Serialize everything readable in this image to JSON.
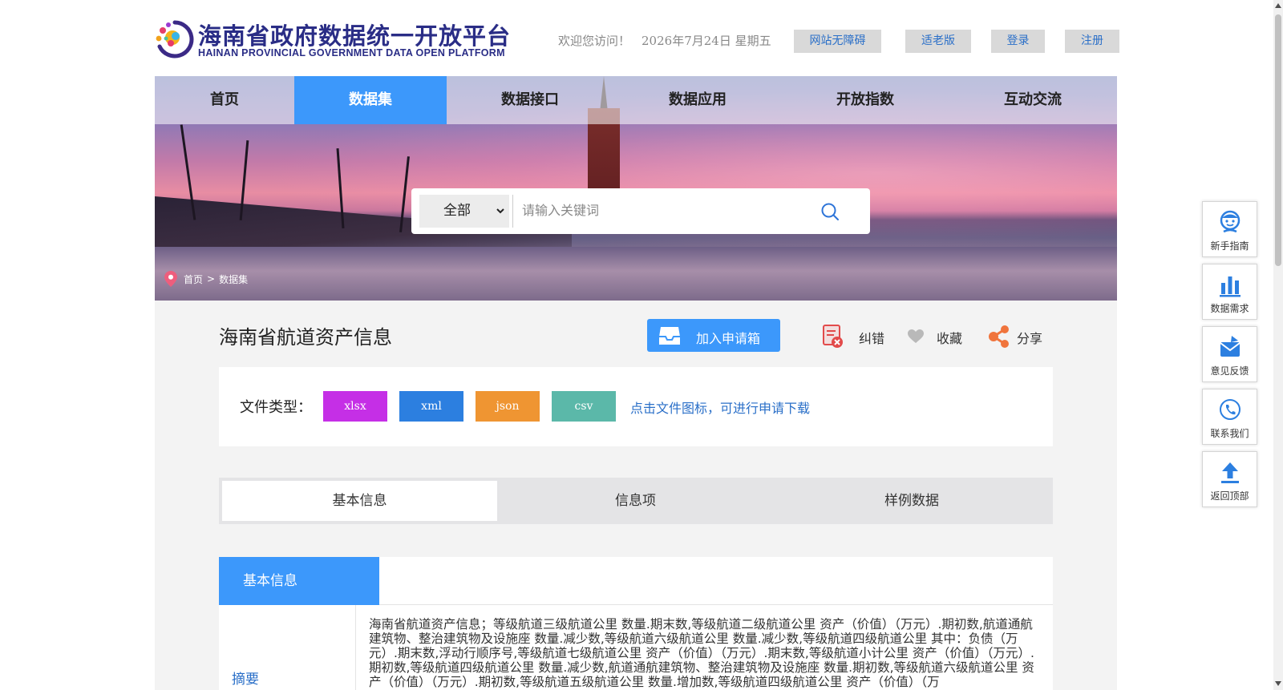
{
  "header": {
    "logo_cn": "海南省政府数据统一开放平台",
    "logo_en": "HAINAN PROVINCIAL GOVERNMENT DATA OPEN PLATFORM",
    "welcome": "欢迎您访问！",
    "date": "2026年7月24日  星期五",
    "buttons": [
      "网站无障碍",
      "适老版",
      "登录",
      "注册"
    ]
  },
  "nav": {
    "items": [
      "首页",
      "数据集",
      "数据接口",
      "数据应用",
      "开放指数",
      "互动交流"
    ],
    "active": "数据集"
  },
  "search": {
    "scope": "全部",
    "placeholder": "请输入关键词"
  },
  "breadcrumb": [
    "首页",
    ">",
    "数据集"
  ],
  "dataset": {
    "title": "海南省航道资产信息",
    "apply_label": "加入申请箱",
    "actions": [
      "纠错",
      "收藏",
      "分享"
    ],
    "filetype_label": "文件类型：",
    "filetypes": [
      {
        "label": "xlsx",
        "color": "#c52fe6"
      },
      {
        "label": "xml",
        "color": "#2c7fe0"
      },
      {
        "label": "json",
        "color": "#ef9532"
      },
      {
        "label": "csv",
        "color": "#5bb8a9"
      }
    ],
    "filetype_hint": "点击文件图标，可进行申请下载"
  },
  "tabs": [
    "基本信息",
    "信息项",
    "样例数据"
  ],
  "info": {
    "header": "基本信息",
    "key": "摘要",
    "value": "海南省航道资产信息；等级航道三级航道公里 数量.期末数,等级航道二级航道公里 资产（价值）（万元）.期初数,航道通航建筑物、整治建筑物及设施座 数量.减少数,等级航道六级航道公里 数量.减少数,等级航道四级航道公里 其中：负债（万元）.期末数,浮动行顺序号,等级航道七级航道公里 资产（价值）（万元）.期末数,等级航道小计公里 资产（价值）（万元）.期初数,等级航道四级航道公里 数量.减少数,航道通航建筑物、整治建筑物及设施座 数量.期初数,等级航道六级航道公里 资产（价值）（万元）.期初数,等级航道五级航道公里 数量.增加数,等级航道四级航道公里 资产（价值）（万"
  },
  "float_menu": [
    {
      "label": "新手指南",
      "icon": "guide-face-icon"
    },
    {
      "label": "数据需求",
      "icon": "bar-chart-icon"
    },
    {
      "label": "意见反馈",
      "icon": "feedback-envelope-icon"
    },
    {
      "label": "联系我们",
      "icon": "phone-icon"
    },
    {
      "label": "返回顶部",
      "icon": "upload-arrow-icon"
    }
  ],
  "colors": {
    "primary": "#3c98fb",
    "logo": "#2a2d86",
    "link": "#2a6fc8"
  }
}
